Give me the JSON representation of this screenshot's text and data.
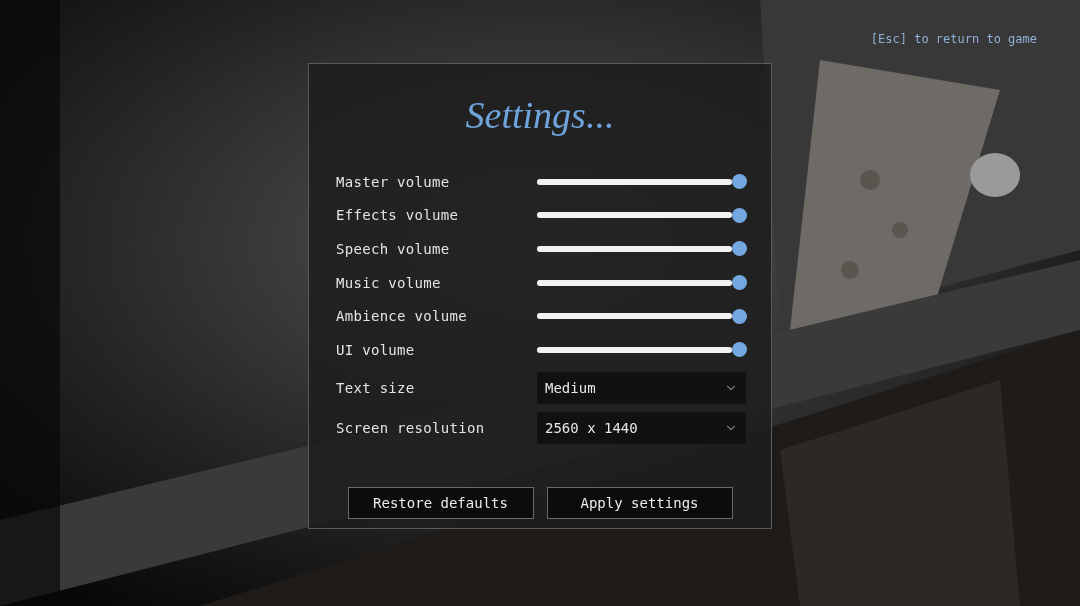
{
  "hint": "[Esc] to return to game",
  "title": "Settings...",
  "sliders": [
    {
      "label": "Master volume",
      "level": 1
    },
    {
      "label": "Effects volume",
      "level": 1
    },
    {
      "label": "Speech volume",
      "level": 1
    },
    {
      "label": "Music volume",
      "level": 1
    },
    {
      "label": "Ambience volume",
      "level": 1
    },
    {
      "label": "UI volume",
      "level": 1
    }
  ],
  "dropdowns": [
    {
      "label": "Text size",
      "value": "Medium"
    },
    {
      "label": "Screen resolution",
      "value": "2560 x 1440"
    }
  ],
  "buttons": [
    "Restore defaults",
    "Apply settings"
  ]
}
